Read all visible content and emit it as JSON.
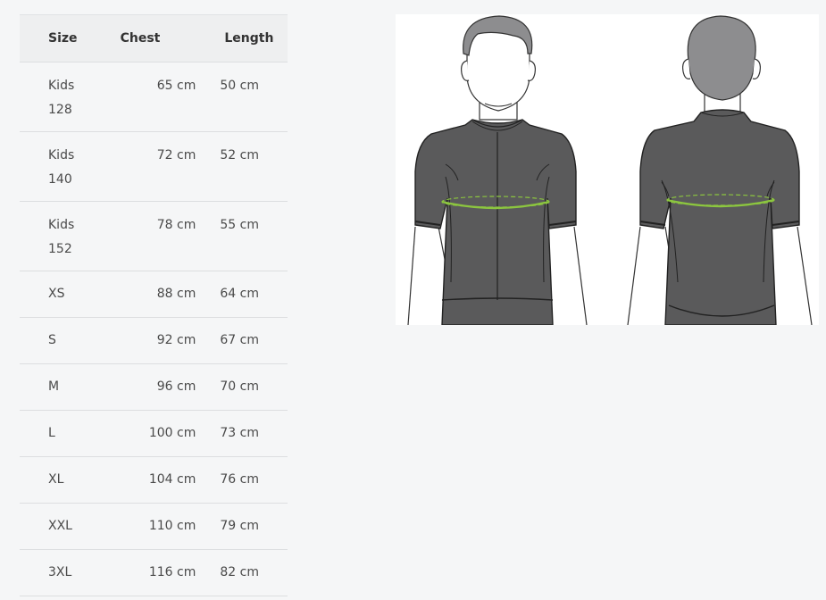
{
  "table": {
    "headers": {
      "size": "Size",
      "chest": "Chest",
      "length": "Length"
    },
    "rows": [
      {
        "size": "Kids 128",
        "chest": "65 cm",
        "length": "50 cm"
      },
      {
        "size": "Kids 140",
        "chest": "72 cm",
        "length": "52 cm"
      },
      {
        "size": "Kids 152",
        "chest": "78 cm",
        "length": "55 cm"
      },
      {
        "size": "XS",
        "chest": "88 cm",
        "length": "64 cm"
      },
      {
        "size": "S",
        "chest": "92 cm",
        "length": "67 cm"
      },
      {
        "size": "M",
        "chest": "96 cm",
        "length": "70 cm"
      },
      {
        "size": "L",
        "chest": "100 cm",
        "length": "73 cm"
      },
      {
        "size": "XL",
        "chest": "104 cm",
        "length": "76 cm"
      },
      {
        "size": "XXL",
        "chest": "110 cm",
        "length": "79 cm"
      },
      {
        "size": "3XL",
        "chest": "116 cm",
        "length": "82 cm"
      }
    ]
  },
  "illustration": {
    "jersey_color": "#5a5a5b",
    "hair_color": "#8d8d8f",
    "measure_color": "#8cc63f"
  }
}
